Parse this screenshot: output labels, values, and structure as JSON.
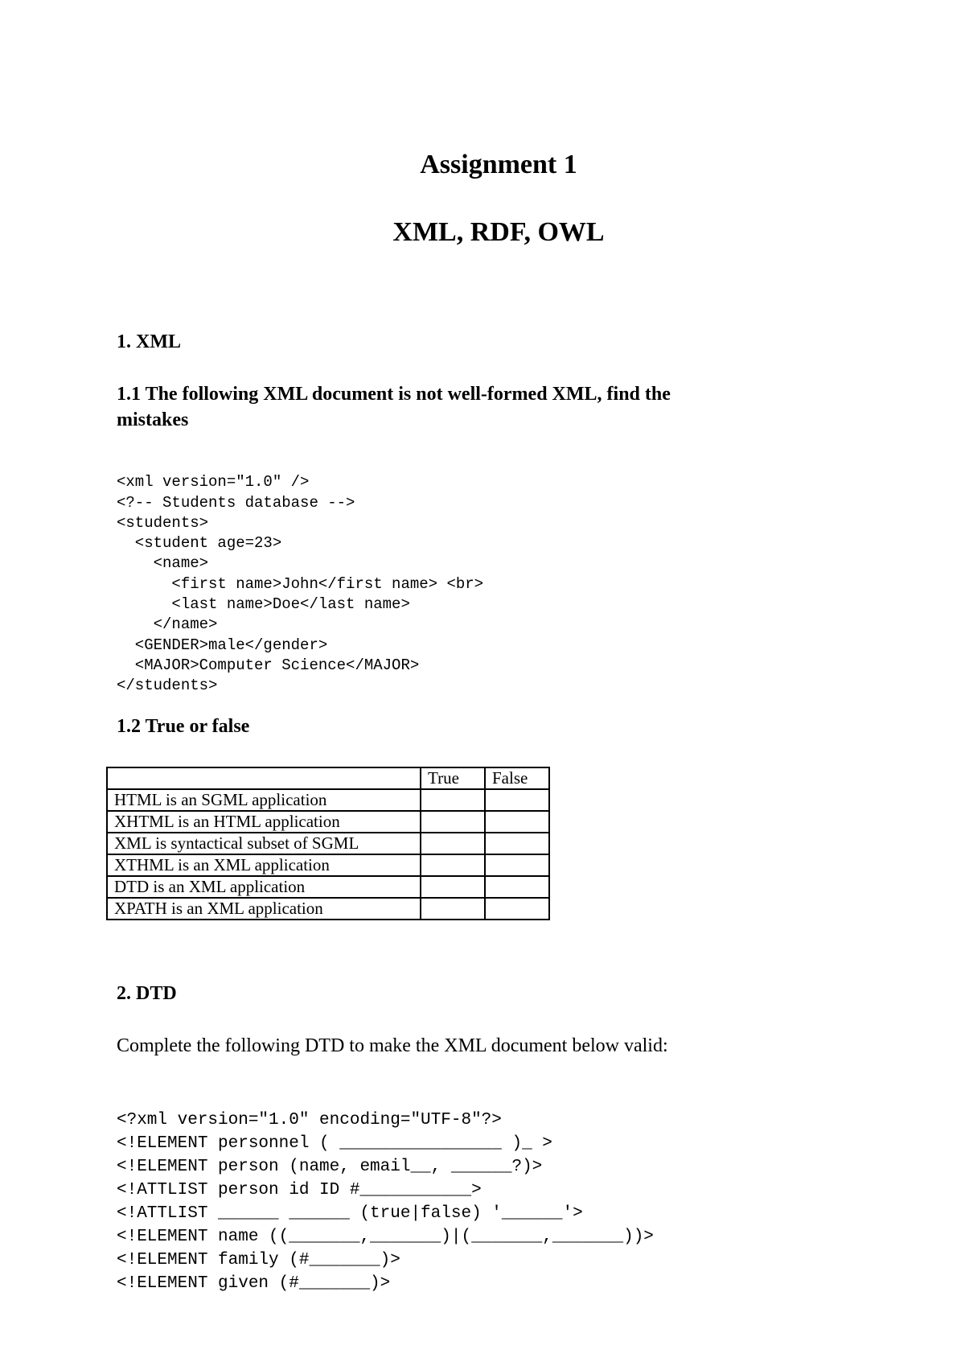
{
  "title": "Assignment 1",
  "subtitle": "XML, RDF, OWL",
  "section1": {
    "heading": "1. XML",
    "q1_heading_line1": "1.1 The following XML document is not well-formed XML, find the",
    "q1_heading_line2": "mistakes",
    "xml_code": [
      "<xml version=\"1.0\" />",
      "<?-- Students database -->",
      "<students>",
      "  <student age=23>",
      "    <name>",
      "      <first name>John</first name> <br>",
      "      <last name>Doe</last name>",
      "    </name>",
      "  <GENDER>male</gender>",
      "  <MAJOR>Computer Science</MAJOR>",
      "</students>"
    ],
    "q2_heading": "1.2 True or false",
    "table": {
      "headers": [
        "",
        "True",
        "False"
      ],
      "rows": [
        "HTML is an SGML application",
        "XHTML is an HTML application",
        "XML is syntactical subset of SGML",
        "XTHML is an XML application",
        "DTD is an XML application",
        "XPATH is an XML application"
      ]
    }
  },
  "section2": {
    "heading": "2. DTD",
    "instruction": "Complete the following DTD to make the XML document below valid:",
    "dtd_code": [
      "<?xml version=\"1.0\" encoding=\"UTF-8\"?>",
      "<!ELEMENT personnel ( ________________ )_ >",
      "<!ELEMENT person (name, email__, ______?)>",
      "<!ATTLIST person id ID #___________>",
      "<!ATTLIST ______ ______ (true|false) '______'>",
      "<!ELEMENT name ((_______,_______)|(_______,_______))>",
      "<!ELEMENT family (#_______)>",
      "<!ELEMENT given (#_______)>"
    ]
  }
}
